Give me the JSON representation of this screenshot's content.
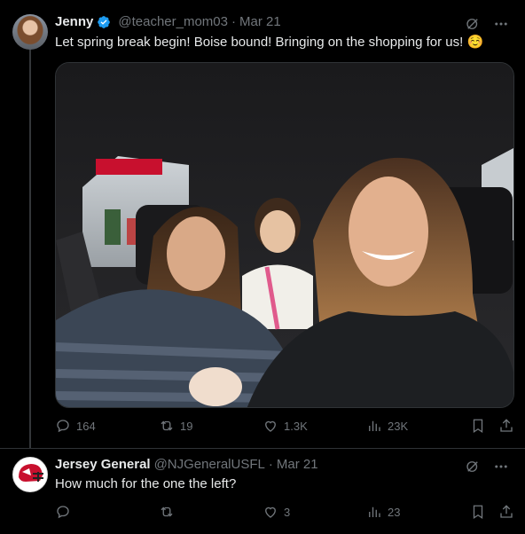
{
  "tweets": [
    {
      "name": "Jenny",
      "handle": "@teacher_mom03",
      "separator": "·",
      "time": "Mar 21",
      "verified": true,
      "text": "Let spring break begin! Boise bound! Bringing on the shopping for us! ☺️",
      "photo_description": "selfie-in-car",
      "stats": {
        "replies": "164",
        "reposts": "19",
        "likes": "1.3K",
        "views": "23K"
      }
    },
    {
      "name": "Jersey General",
      "handle": "@NJGeneralUSFL",
      "separator": "·",
      "time": "Mar 21",
      "verified": false,
      "text": "How much for the one the left?",
      "stats": {
        "replies": "",
        "reposts": "",
        "likes": "3",
        "views": "23"
      }
    }
  ],
  "colors": {
    "background": "#000000",
    "text": "#e7e9ea",
    "muted": "#71767b",
    "verified": "#1d9bf0",
    "avatar_red": "#c8102e"
  },
  "icons": [
    "grok-icon",
    "more-icon",
    "reply-icon",
    "repost-icon",
    "like-icon",
    "views-icon",
    "bookmark-icon",
    "share-icon",
    "verified-badge-icon"
  ]
}
